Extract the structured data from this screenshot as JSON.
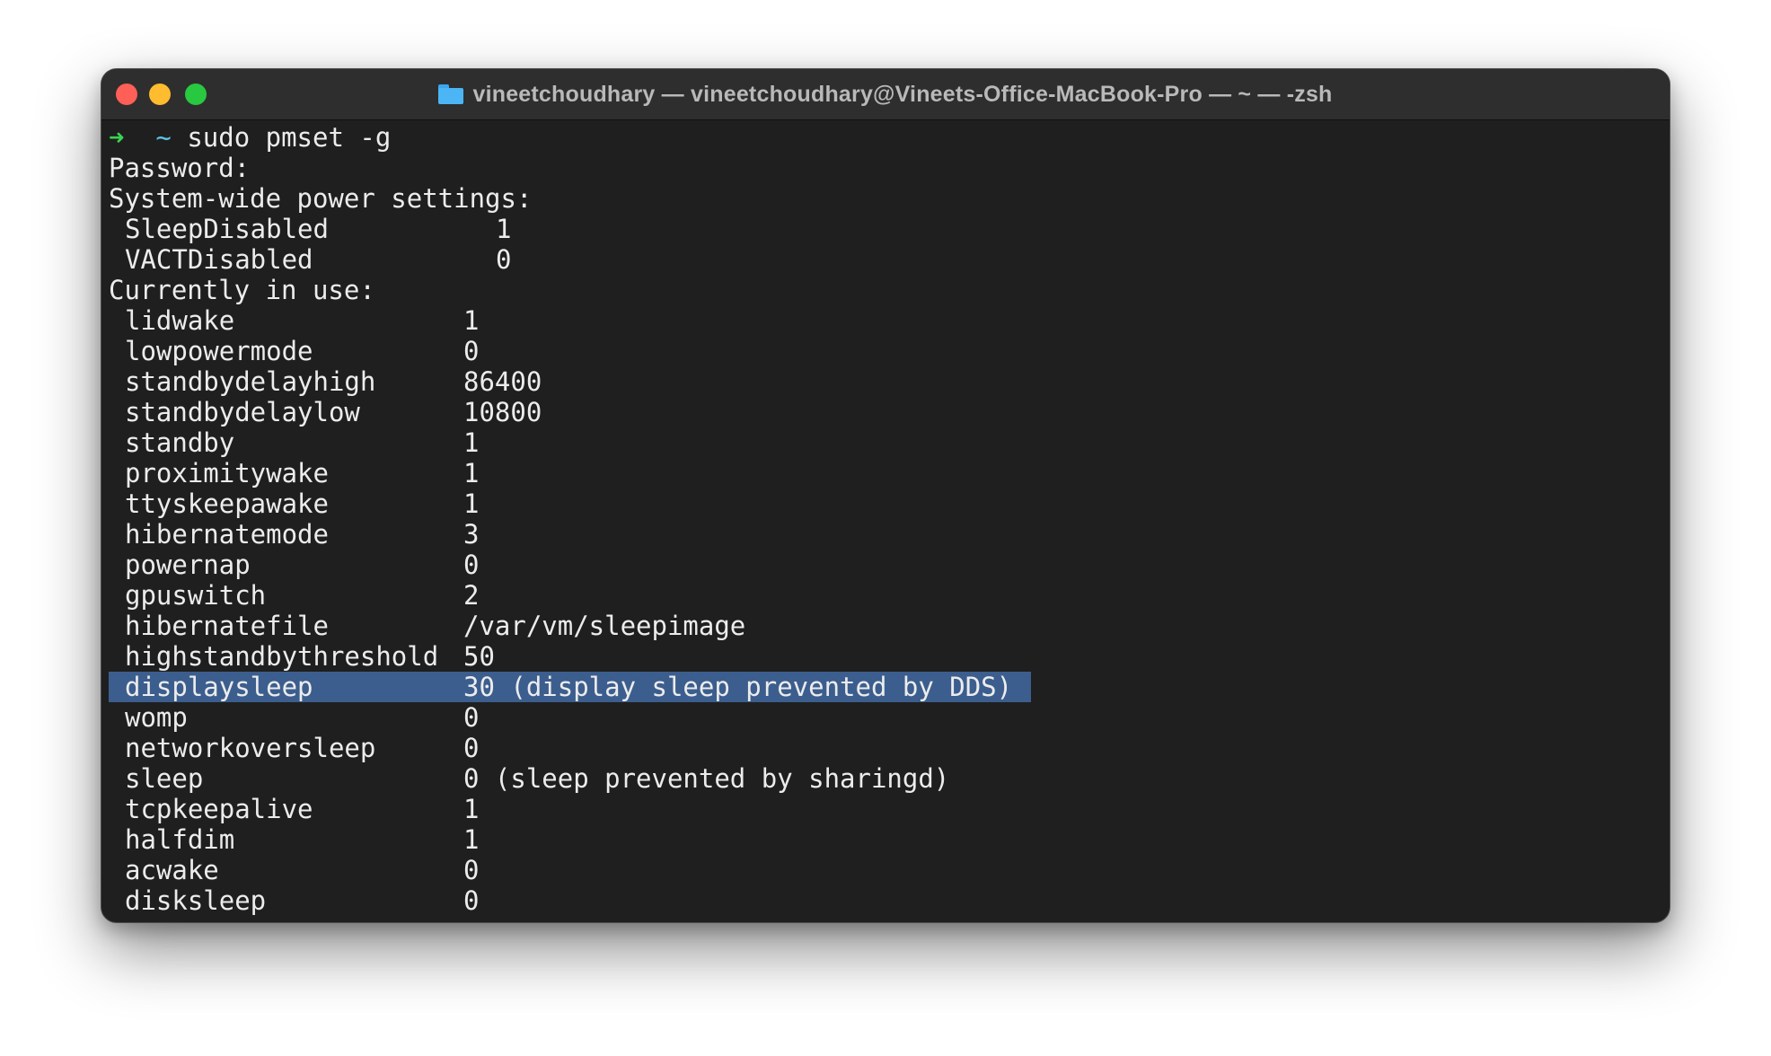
{
  "window": {
    "title": "vineetchoudhary — vineetchoudhary@Vineets-Office-MacBook-Pro — ~ — -zsh",
    "title_icon": "folder-icon",
    "controls": [
      "close",
      "minimize",
      "zoom"
    ]
  },
  "terminal": {
    "prompt_symbol": "➜",
    "prompt_dir": "~",
    "command": "sudo pmset -g",
    "password_line": "Password:",
    "system_header": "System-wide power settings:",
    "system_settings": [
      {
        "key": "SleepDisabled",
        "value": "1"
      },
      {
        "key": "VACTDisabled",
        "value": "0"
      }
    ],
    "current_header": "Currently in use:",
    "current_settings": [
      {
        "key": "lidwake",
        "value": "1"
      },
      {
        "key": "lowpowermode",
        "value": "0"
      },
      {
        "key": "standbydelayhigh",
        "value": "86400"
      },
      {
        "key": "standbydelaylow",
        "value": "10800"
      },
      {
        "key": "standby",
        "value": "1"
      },
      {
        "key": "proximitywake",
        "value": "1"
      },
      {
        "key": "ttyskeepawake",
        "value": "1"
      },
      {
        "key": "hibernatemode",
        "value": "3"
      },
      {
        "key": "powernap",
        "value": "0"
      },
      {
        "key": "gpuswitch",
        "value": "2"
      },
      {
        "key": "hibernatefile",
        "value": "/var/vm/sleepimage"
      },
      {
        "key": "highstandbythreshold",
        "value": "50"
      },
      {
        "key": "displaysleep",
        "value": "30 (display sleep prevented by DDS)"
      },
      {
        "key": "womp",
        "value": "0"
      },
      {
        "key": "networkoversleep",
        "value": "0"
      },
      {
        "key": "sleep",
        "value": "0 (sleep prevented by sharingd)"
      },
      {
        "key": "tcpkeepalive",
        "value": "1"
      },
      {
        "key": "halfdim",
        "value": "1"
      },
      {
        "key": "acwake",
        "value": "0"
      },
      {
        "key": "disksleep",
        "value": "0"
      }
    ],
    "highlight_color": "#3c5e8e",
    "prompt_arrow_color": "#39d353",
    "prompt_dir_color": "#5fc1e6"
  }
}
